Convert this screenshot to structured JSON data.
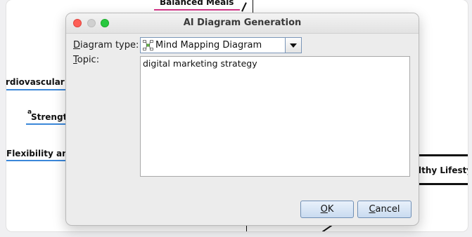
{
  "mindmap": {
    "node_top": "Balanced Meals",
    "node_cardio": "rdiovascular",
    "node_strength": "Strength",
    "node_strength_mark": "a",
    "node_flex": "Flexibility an",
    "node_center": "lthy Lifesty"
  },
  "dialog": {
    "title": "AI Diagram Generation",
    "diagram_type_label_first": "D",
    "diagram_type_label_rest": "iagram type:",
    "diagram_type_value": "Mind Mapping Diagram",
    "topic_label_first": "T",
    "topic_label_rest": "opic:",
    "topic_value": "digital marketing strategy",
    "ok_first": "O",
    "ok_rest": "K",
    "cancel_first": "C",
    "cancel_rest": "ancel"
  },
  "icons": {
    "combo_icon": "mind-map-icon",
    "dropdown": "chevron-down-icon"
  },
  "colors": {
    "close": "#fe5f57",
    "minimize": "#d0d0d0",
    "maximize": "#28c840",
    "branch_blue": "#3b87d9",
    "branch_pink": "#d6368a"
  }
}
